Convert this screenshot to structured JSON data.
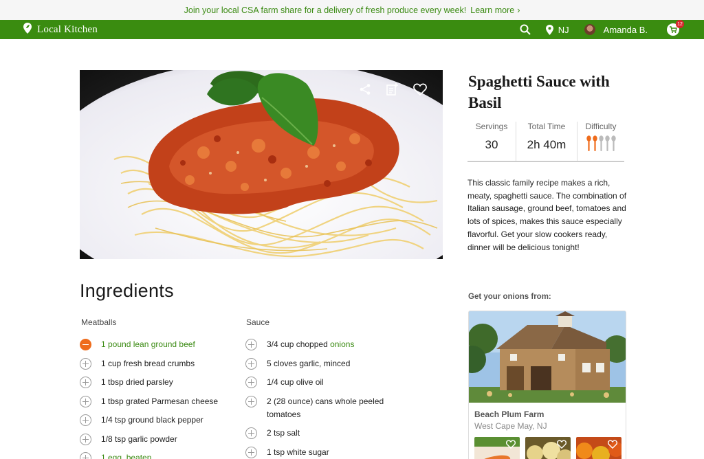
{
  "promo": {
    "text": "Join your local CSA farm share for a delivery of fresh produce every week!",
    "link": "Learn more",
    "chevron": "›"
  },
  "nav": {
    "brand": "Local Kitchen",
    "brand_icon": "location-pin-leaf-icon",
    "location": "NJ",
    "user": "Amanda B.",
    "cart_count": "12",
    "color": "#3a8c10"
  },
  "recipe": {
    "title": "Spaghetti Sauce with Basil",
    "stats": {
      "servings_label": "Servings",
      "servings": "30",
      "time_label": "Total Time",
      "time": "2h 40m",
      "difficulty_label": "Difficulty",
      "difficulty_level": 2,
      "difficulty_max": 5
    },
    "description": "This classic family recipe makes a rich, meaty, spaghetti sauce. The combination of Italian sausage, ground beef, tomatoes and lots of spices, makes this sauce especially flavorful. Get your slow cookers ready, dinner will be delicious tonight!"
  },
  "ingredients": {
    "heading": "Ingredients",
    "meatballs": {
      "heading": "Meatballs",
      "items": [
        {
          "pre": "",
          "green": "1 pound lean ground beef",
          "post": "",
          "active": true
        },
        {
          "pre": "1 cup fresh bread crumbs",
          "green": "",
          "post": ""
        },
        {
          "pre": "1 tbsp dried parsley",
          "green": "",
          "post": ""
        },
        {
          "pre": "1 tbsp grated Parmesan cheese",
          "green": "",
          "post": ""
        },
        {
          "pre": "1/4 tsp ground black pepper",
          "green": "",
          "post": ""
        },
        {
          "pre": "1/8 tsp garlic powder",
          "green": "",
          "post": ""
        },
        {
          "pre": "",
          "green": "1 egg, beaten",
          "post": ""
        }
      ]
    },
    "sauce": {
      "heading": "Sauce",
      "items": [
        {
          "pre": "3/4 cup chopped ",
          "green": "onions",
          "post": ""
        },
        {
          "pre": "5 cloves garlic, minced",
          "green": "",
          "post": ""
        },
        {
          "pre": "1/4 cup olive oil",
          "green": "",
          "post": ""
        },
        {
          "pre": "2 (28 ounce) cans whole peeled tomatoes",
          "green": "",
          "post": ""
        },
        {
          "pre": "2 tsp salt",
          "green": "",
          "post": ""
        },
        {
          "pre": "1 tsp white sugar",
          "green": "",
          "post": ""
        }
      ]
    }
  },
  "farm": {
    "heading": "Get your onions from:",
    "name": "Beach Plum Farm",
    "location": "West Cape May, NJ"
  }
}
